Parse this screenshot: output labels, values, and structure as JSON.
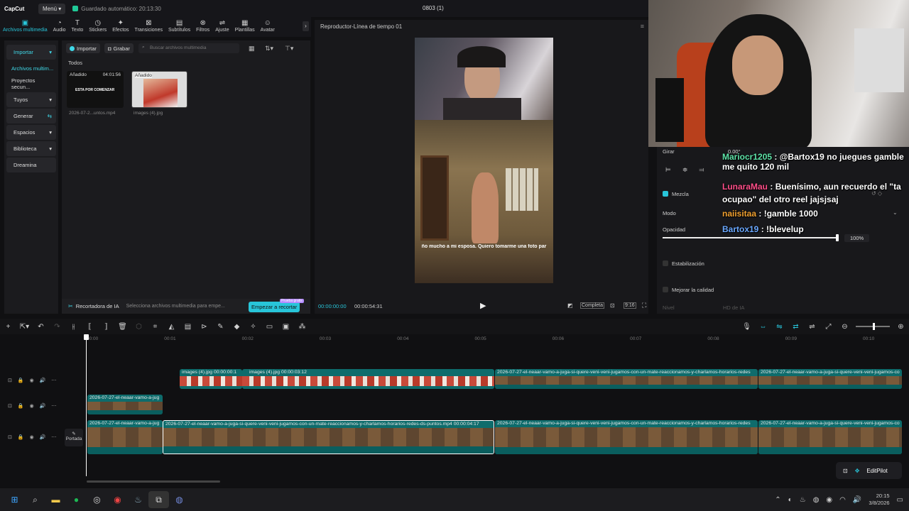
{
  "topbar": {
    "logo": "CapCut",
    "menu": "Menú",
    "autosave": "Guardado automático: 20:13:30",
    "project": "0803 (1)"
  },
  "tools": [
    {
      "icon": "▣",
      "label": "Archivos multimedia",
      "active": true
    },
    {
      "icon": "◔",
      "label": "Audio"
    },
    {
      "icon": "T",
      "label": "Texto"
    },
    {
      "icon": "◷",
      "label": "Stickers"
    },
    {
      "icon": "✦",
      "label": "Efectos"
    },
    {
      "icon": "⊠",
      "label": "Transiciones"
    },
    {
      "icon": "▤",
      "label": "Subtítulos"
    },
    {
      "icon": "⊗",
      "label": "Filtros"
    },
    {
      "icon": "⇌",
      "label": "Ajuste"
    },
    {
      "icon": "▦",
      "label": "Plantillas"
    },
    {
      "icon": "☺",
      "label": "Avatar"
    }
  ],
  "leftnav": {
    "import": "Importar",
    "items": [
      "Archivos multim...",
      "Proyectos secun...",
      "Tuyos",
      "Generar",
      "Espacios",
      "Biblioteca",
      "Dreamina"
    ]
  },
  "media": {
    "import": "Importar",
    "record": "Grabar",
    "search_placeholder": "Buscar archivos multimedia",
    "section": "Todos",
    "items": [
      {
        "badge": "Añadido",
        "duration": "04:01:56",
        "name": "2026-07-2...untos.mp4",
        "thumb_text": "ESTA POR COMENZAR"
      },
      {
        "badge": "Añadido",
        "name": "images (4).jpg"
      }
    ]
  },
  "aibar": {
    "title": "Recortadora de IA",
    "hint": "Selecciona archivos multimedia para empe...",
    "button": "Empezar a recortar",
    "badge": "Prueba gratis"
  },
  "player": {
    "title": "Reproductor-Línea de tiempo 01",
    "current": "00:00:00:00",
    "total": "00:00:54:31",
    "full": "Completa",
    "ratio": "9:16",
    "subtitle": "ño mucho a mi esposa. Quiero tomarme una foto par"
  },
  "props": {
    "rotate": "Girar",
    "rotate_val": "0.00°",
    "blend": "Mezcla",
    "mode": "Modo",
    "opacity": "Opacidad",
    "opacity_val": "100%",
    "stabilize": "Estabilización",
    "enhance": "Mejorar la calidad",
    "level": "Nivel",
    "level_val": "HD de IA"
  },
  "chat": [
    {
      "user": "Mariocr1205",
      "user_color": "#5ee3a8",
      "msg": "@Bartox19 no juegues gamble me quito 120 mil",
      "mention": "@Bartox19"
    },
    {
      "user": "LunaraMau",
      "user_color": "#ff4f8a",
      "msg": "Buenísimo, aun recuerdo el \"ta ocupao\" del otro reel jajsjsaj"
    },
    {
      "user": "naiisitaa",
      "user_color": "#f0a030",
      "msg": "!gamble 1000"
    },
    {
      "user": "Bartox19",
      "user_color": "#6aa8ff",
      "msg": "!blevelup"
    }
  ],
  "timeline": {
    "ticks": [
      "00:00",
      "00:01",
      "00:02",
      "00:03",
      "00:04",
      "00:05",
      "00:06",
      "00:07",
      "00:08",
      "00:09",
      "00:10"
    ],
    "cover": "Portada",
    "clips": {
      "img1": "images (4).jpg  00:00:00:1",
      "img2": "images (4).jpg  00:00:03:12",
      "long": "2026-07-27-el-neaar-vamo-a-juga-si-quere-veni-veni-jugamos-con-un-mate-reaccionamos-y-charlamos-horarios-redes",
      "short": "2026-07-27-el-neaar-vamo-a-jug",
      "main": "2026-07-27-el-neaar-vamo-a-juga-si-quere-veni-veni-jugamos-con-un-mate-reaccionamos-y-charlamos-horarios-redes-ds-puntos.mp4   00:00:04:17",
      "ext": "2026-07-27-el-neaar-vamo-a-juga-si-quere-veni-veni-jugamos-co"
    }
  },
  "editpilot": "EditPilot",
  "clock": {
    "time": "20:15",
    "date": "3/8/2026"
  }
}
